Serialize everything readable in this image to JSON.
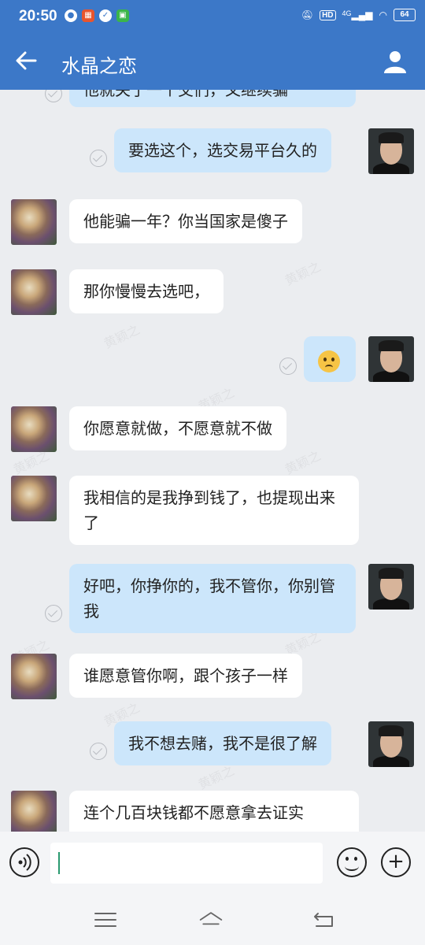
{
  "status_bar": {
    "time": "20:50",
    "hd": "HD",
    "network": "4G",
    "battery": "64"
  },
  "header": {
    "title": "水晶之恋"
  },
  "messages": [
    {
      "side": "out",
      "text": "他就关了一个交们，又继续骗",
      "partial": true
    },
    {
      "side": "out",
      "text": "要选这个，选交易平台久的"
    },
    {
      "side": "in",
      "text": "他能骗一年？你当国家是傻子"
    },
    {
      "side": "in",
      "text": "那你慢慢去选吧，"
    },
    {
      "side": "out",
      "text": "",
      "emoji": "worried-face"
    },
    {
      "side": "in",
      "text": "你愿意就做，不愿意就不做"
    },
    {
      "side": "in",
      "text": "我相信的是我挣到钱了，也提现出来了"
    },
    {
      "side": "out",
      "text": "好吧，你挣你的，我不管你，你别管我"
    },
    {
      "side": "in",
      "text": "谁愿意管你啊，跟个孩子一样"
    },
    {
      "side": "out",
      "text": "我不想去赌，我不是很了解"
    },
    {
      "side": "in",
      "text": "连个几百块钱都不愿意拿去证实",
      "partial": true
    }
  ],
  "watermark": "黄颖之",
  "input": {
    "value": ""
  }
}
